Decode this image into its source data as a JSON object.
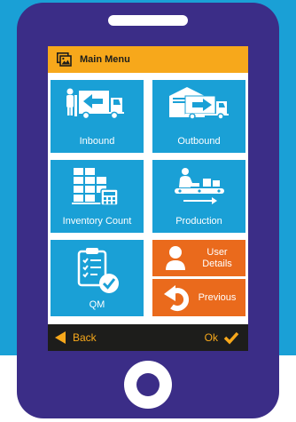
{
  "header": {
    "title": "Main Menu",
    "icon": "image-gallery-icon"
  },
  "tiles": [
    {
      "label": "Inbound",
      "icon": "inbound-truck-icon"
    },
    {
      "label": "Outbound",
      "icon": "outbound-truck-icon"
    },
    {
      "label": "Inventory Count",
      "icon": "inventory-count-icon"
    },
    {
      "label": "Production",
      "icon": "production-conveyor-icon"
    },
    {
      "label": "QM",
      "icon": "qm-checklist-icon"
    },
    {
      "label": "User Details",
      "icon": "user-icon"
    },
    {
      "label": "Previous",
      "icon": "undo-arrow-icon"
    }
  ],
  "footer": {
    "back_label": "Back",
    "ok_label": "Ok"
  },
  "colors": {
    "background": "#1aa0d6",
    "phone_body": "#3b2d87",
    "header": "#f7a81b",
    "tile_blue": "#1aa0d6",
    "tile_orange": "#ea6a1c",
    "footer_bar": "#1d1d1b",
    "footer_text": "#f7a81b"
  }
}
